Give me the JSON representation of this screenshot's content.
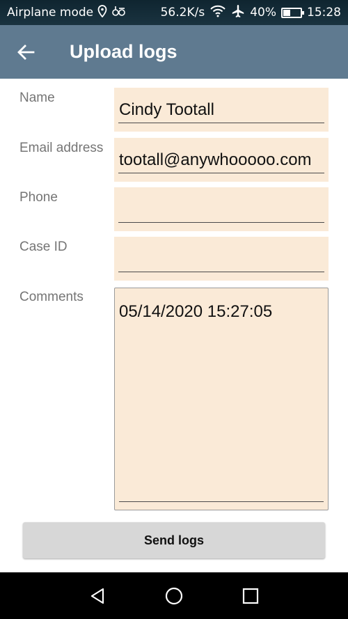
{
  "status_bar": {
    "mode": "Airplane mode",
    "speed": "56.2K/s",
    "battery": "40%",
    "battery_level": 0.4,
    "time": "15:28"
  },
  "toolbar": {
    "title": "Upload logs"
  },
  "form": {
    "name_label": "Name",
    "name_value": "Cindy Tootall",
    "email_label": "Email address",
    "email_value": "tootall@anywhooooo.com",
    "phone_label": "Phone",
    "phone_value": "",
    "case_label": "Case ID",
    "case_value": "",
    "comments_label": "Comments",
    "comments_value": "05/14/2020 15:27:05"
  },
  "actions": {
    "send_label": "Send logs"
  },
  "colors": {
    "toolbar": "#5f7a90",
    "field_bg": "#faead7",
    "button_bg": "#d7d7d7",
    "label": "#757575"
  }
}
